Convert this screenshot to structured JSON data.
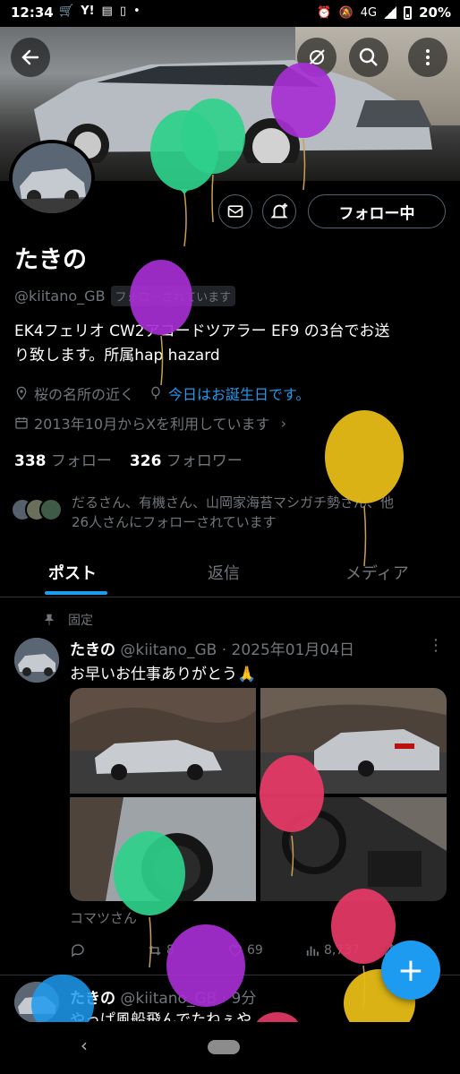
{
  "status_bar": {
    "time": "12:34",
    "network": "4G",
    "battery": "20%",
    "icons": [
      "cart-icon",
      "yahoo-icon",
      "news-icon",
      "app-icon",
      "dot-icon",
      "alarm-icon",
      "mute-icon",
      "signal-icon",
      "battery-icon"
    ]
  },
  "header": {
    "icons": [
      "back-arrow-icon",
      "grok-icon",
      "search-icon",
      "more-vertical-icon"
    ]
  },
  "profile": {
    "name": "たきの",
    "handle": "@kiitano_GB",
    "follows_you_badge": "フォローされています",
    "follow_button": "フォロー中",
    "bio_line1": "EK4フェリオ CW2アコードツアラー EF9 の3台でお送",
    "bio_line2": "り致します。所属hap hazard",
    "location": "桜の名所の近く",
    "birthday": "今日はお誕生日です。",
    "joined": "2013年10月からXを利用しています",
    "following_count": "338",
    "following_label": "フォロー",
    "followers_count": "326",
    "followers_label": "フォロワー",
    "followed_by_line1": "だるさん、有機さん、山岡家海苔マシガチ勢さん、他",
    "followed_by_line2": "26人さんにフォローされています"
  },
  "tabs": [
    {
      "label": "ポスト",
      "active": true
    },
    {
      "label": "返信",
      "active": false
    },
    {
      "label": "メディア",
      "active": false
    }
  ],
  "pinned_post": {
    "pinned_label": "固定",
    "author": "たきの",
    "handle_date": "@kiitano_GB · 2025年01月04日",
    "text": "お早いお仕事ありがとう🙏",
    "caption": "コマツさん",
    "replies": "",
    "reposts": "8",
    "likes": "69",
    "views": "8,737"
  },
  "second_post": {
    "author": "たきの",
    "handle_time": "@kiitano_GB · 9分",
    "text": "やっぱ風船飛んでたねぇや"
  },
  "colors": {
    "accent": "#1d9bf0",
    "background": "#000000",
    "muted_text": "#71767b",
    "balloon_purple": "#a72fd3",
    "balloon_green": "#2ed08b",
    "balloon_yellow": "#e6bc16",
    "balloon_red": "#e83a67"
  }
}
